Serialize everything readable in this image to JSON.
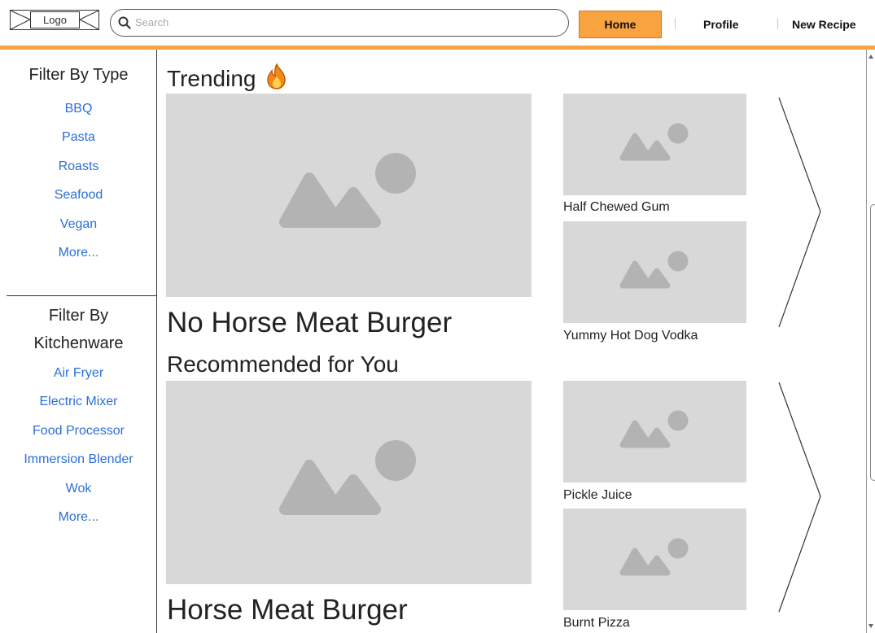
{
  "header": {
    "logo_label": "Logo",
    "search_placeholder": "Search",
    "nav": {
      "home": "Home",
      "profile": "Profile",
      "new_recipe": "New Recipe"
    },
    "accent_color": "#f8a340"
  },
  "sidebar": {
    "type_title": "Filter By Type",
    "type_items": [
      "BBQ",
      "Pasta",
      "Roasts",
      "Seafood",
      "Vegan",
      "More..."
    ],
    "kitchen_title_line1": "Filter By",
    "kitchen_title_line2": "Kitchenware",
    "kitchen_items": [
      "Air Fryer",
      "Electric Mixer",
      "Food Processor",
      "Immersion Blender",
      "Wok",
      "More..."
    ],
    "link_color": "#2b6fd8"
  },
  "trending": {
    "title": "Trending",
    "icon": "fire-icon",
    "featured_title": "No Horse Meat Burger",
    "side_items": [
      "Half Chewed Gum",
      "Yummy Hot Dog Vodka"
    ]
  },
  "recommended": {
    "title": "Recommended for You",
    "featured_title": "Horse Meat Burger",
    "side_items": [
      "Pickle Juice",
      "Burnt Pizza"
    ]
  },
  "icons": {
    "image_placeholder": "image-placeholder-icon",
    "next_arrow": "chevron-right-icon",
    "search": "search-icon"
  }
}
